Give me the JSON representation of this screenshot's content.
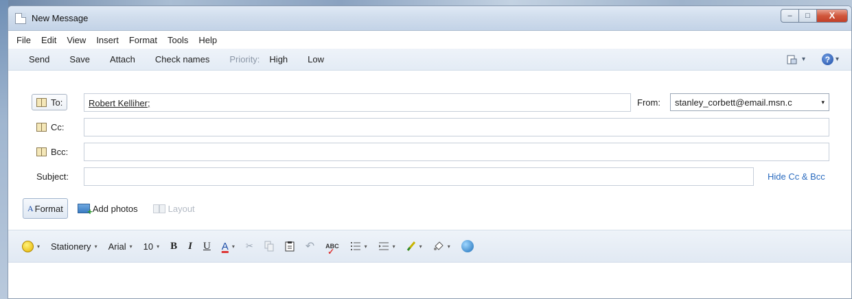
{
  "window": {
    "title": "New Message",
    "controls": {
      "minimize": "–",
      "maximize": "□",
      "close": "X"
    }
  },
  "menubar": [
    "File",
    "Edit",
    "View",
    "Insert",
    "Format",
    "Tools",
    "Help"
  ],
  "toolbar": {
    "send": "Send",
    "save": "Save",
    "attach": "Attach",
    "check_names": "Check names",
    "priority_label": "Priority:",
    "priority_high": "High",
    "priority_low": "Low",
    "dropdown_glyph": "▾"
  },
  "header": {
    "to_label": "To:",
    "to_value": "Robert Kelliher;",
    "cc_label": "Cc:",
    "cc_value": "",
    "bcc_label": "Bcc:",
    "bcc_value": "",
    "subject_label": "Subject:",
    "subject_value": "",
    "from_label": "From:",
    "from_value": "stanley_corbett@email.msn.c",
    "hide_cc_bcc": "Hide Cc & Bcc"
  },
  "format_bar": {
    "format_tab": "Format",
    "add_photos": "Add photos",
    "layout": "Layout"
  },
  "edit_bar": {
    "stationery": "Stationery",
    "font_name": "Arial",
    "font_size": "10",
    "bold": "B",
    "italic": "I",
    "underline": "U",
    "font_color": "A"
  },
  "colors": {
    "link": "#2a6bbf",
    "toolbar_bg": "#e3ebf5",
    "close_red": "#c2402a"
  }
}
